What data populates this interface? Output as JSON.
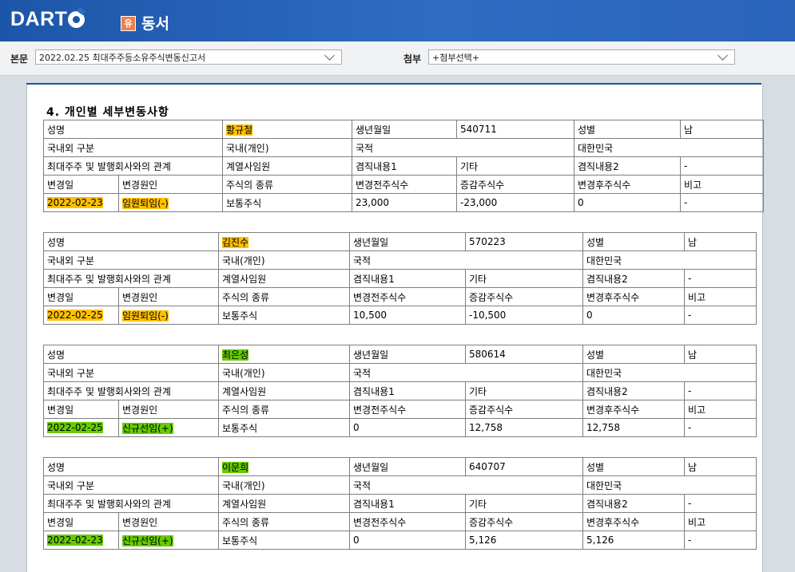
{
  "header": {
    "logo_text": "DART",
    "company_badge": "유",
    "company_name": "동서"
  },
  "toolbar": {
    "body_label": "본문",
    "body_select_value": "2022.02.25  최대주주등소유주식변동신고서",
    "attach_label": "첨부",
    "attach_select_value": "+첨부선택+"
  },
  "section_title": "4. 개인별 세부변동사항",
  "labels": {
    "name": "성명",
    "birth": "생년월일",
    "gender": "성별",
    "domestic": "국내외 구분",
    "nationality": "국적",
    "relation": "최대주주 및 발행회사와의 관계",
    "concurrent1": "겸직내용1",
    "concurrent2": "겸직내용2",
    "change_date": "변경일",
    "change_reason": "변경원인",
    "stock_type": "주식의 종류",
    "before": "변경전주식수",
    "delta": "증감주식수",
    "after": "변경후주식수",
    "remarks": "비고"
  },
  "records": [
    {
      "name": "황규철",
      "birth": "540711",
      "gender": "남",
      "domestic": "국내(개인)",
      "nationality": "대한민국",
      "relation": "계열사임원",
      "concurrent1": "기타",
      "concurrent2": "-",
      "change_date": "2022-02-23",
      "change_reason": "임원퇴임(-)",
      "stock_type": "보통주식",
      "before": "23,000",
      "delta": "-23,000",
      "after": "0",
      "remarks": "-",
      "highlight_color": "#ffc000"
    },
    {
      "name": "김진수",
      "birth": "570223",
      "gender": "남",
      "domestic": "국내(개인)",
      "nationality": "대한민국",
      "relation": "계열사임원",
      "concurrent1": "기타",
      "concurrent2": "-",
      "change_date": "2022-02-25",
      "change_reason": "임원퇴임(-)",
      "stock_type": "보통주식",
      "before": "10,500",
      "delta": "-10,500",
      "after": "0",
      "remarks": "-",
      "highlight_color": "#ffc000"
    },
    {
      "name": "최은성",
      "birth": "580614",
      "gender": "남",
      "domestic": "국내(개인)",
      "nationality": "대한민국",
      "relation": "계열사임원",
      "concurrent1": "기타",
      "concurrent2": "-",
      "change_date": "2022-02-25",
      "change_reason": "신규선임(+)",
      "stock_type": "보통주식",
      "before": "0",
      "delta": "12,758",
      "after": "12,758",
      "remarks": "-",
      "highlight_color": "#66cc00"
    },
    {
      "name": "이문희",
      "birth": "640707",
      "gender": "남",
      "domestic": "국내(개인)",
      "nationality": "대한민국",
      "relation": "계열사임원",
      "concurrent1": "기타",
      "concurrent2": "-",
      "change_date": "2022-02-23",
      "change_reason": "신규선임(+)",
      "stock_type": "보통주식",
      "before": "0",
      "delta": "5,126",
      "after": "5,126",
      "remarks": "-",
      "highlight_color": "#66cc00"
    }
  ]
}
